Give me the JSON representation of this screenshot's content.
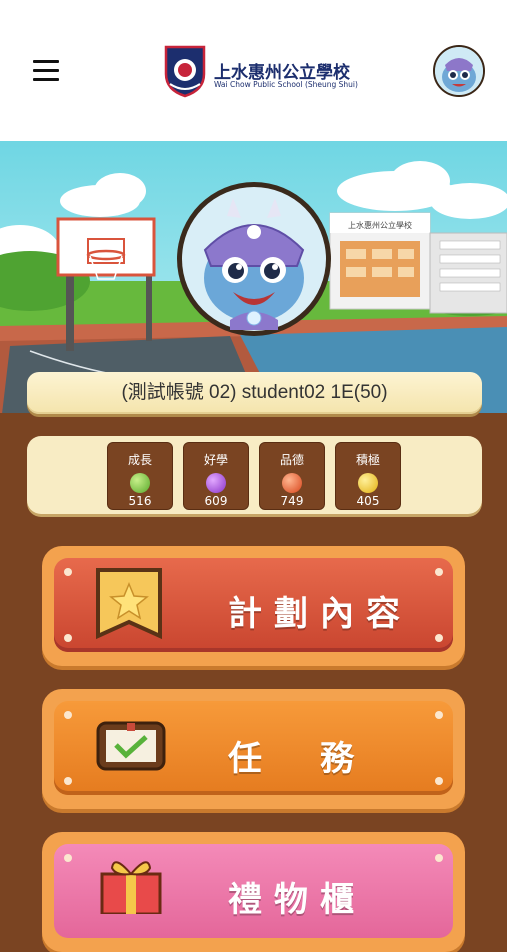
{
  "header": {
    "school_name_zh": "上水惠州公立學校",
    "school_name_en": "Wai Chow Public School (Sheung Shui)"
  },
  "scene": {
    "building_sign": "上水惠州公立學校"
  },
  "profile": {
    "display_name": "(測試帳號 02) student02 1E(50)"
  },
  "stats": [
    {
      "label": "成長",
      "value": "516",
      "color": "#6ec23a"
    },
    {
      "label": "好學",
      "value": "609",
      "color": "#9b3fd4"
    },
    {
      "label": "品德",
      "value": "749",
      "color": "#e8521f"
    },
    {
      "label": "積極",
      "value": "405",
      "color": "#f2c21a"
    }
  ],
  "menu": {
    "plan": "計劃內容",
    "tasks": "任　務",
    "gifts": "禮物櫃"
  },
  "colors": {
    "plan_button": "#d8533a",
    "tasks_button": "#ee8a2c",
    "gifts_button": "#ec6fa3",
    "frame": "#f3a24e"
  }
}
